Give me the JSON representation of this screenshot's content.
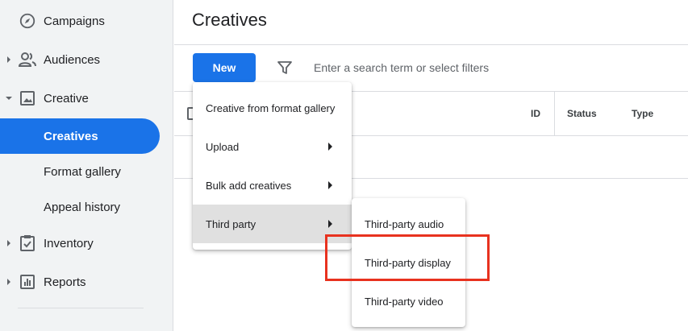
{
  "sidebar": {
    "items": [
      {
        "label": "Campaigns",
        "icon": "compass-icon",
        "caret": false
      },
      {
        "label": "Audiences",
        "icon": "people-icon",
        "caret": "right"
      },
      {
        "label": "Creative",
        "icon": "image-icon",
        "caret": "down"
      },
      {
        "label": "Creatives",
        "active": true
      },
      {
        "label": "Format gallery"
      },
      {
        "label": "Appeal history"
      },
      {
        "label": "Inventory",
        "icon": "clipboard-check-icon",
        "caret": "right"
      },
      {
        "label": "Reports",
        "icon": "bar-chart-icon",
        "caret": "right"
      }
    ]
  },
  "header": {
    "title": "Creatives"
  },
  "toolbar": {
    "new_label": "New",
    "search_placeholder": "Enter a search term or select filters"
  },
  "table": {
    "columns": [
      "ID",
      "Status",
      "Type"
    ]
  },
  "new_menu": {
    "items": [
      {
        "label": "Creative from format gallery"
      },
      {
        "label": "Upload",
        "submenu": true
      },
      {
        "label": "Bulk add creatives",
        "submenu": true
      },
      {
        "label": "Third party",
        "submenu": true,
        "highlighted": true
      }
    ]
  },
  "third_party_menu": {
    "items": [
      {
        "label": "Third-party audio"
      },
      {
        "label": "Third-party display",
        "annotated": true
      },
      {
        "label": "Third-party video"
      }
    ]
  },
  "colors": {
    "accent": "#1a73e8",
    "annotation": "#e8321f",
    "sidebar_bg": "#f1f3f4",
    "menu_highlight": "#e0e0e0"
  }
}
